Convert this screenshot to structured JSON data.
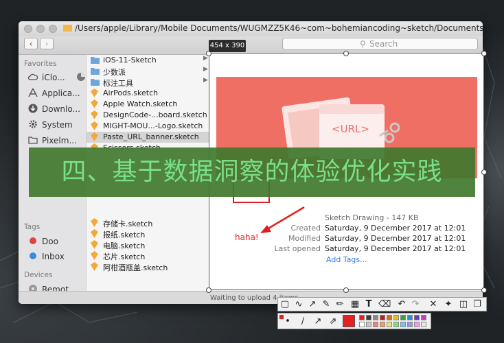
{
  "window": {
    "path": "/Users/apple/Library/Mobile Documents/WUGMZZ5K46~com~bohemiancoding~sketch/Documents",
    "search_placeholder": "Search",
    "status": "Waiting to upload 4 items"
  },
  "sidebar": {
    "favorites_header": "Favorites",
    "favorites": [
      "iClo...",
      "Applica...",
      "Downlo...",
      "System",
      "Pixelm..."
    ],
    "tags_header": "Tags",
    "tags": [
      {
        "label": "Doo",
        "color": "#e0443e"
      },
      {
        "label": "Inbox",
        "color": "#3c8be0"
      }
    ],
    "devices_header": "Devices",
    "devices": [
      "Remot..."
    ]
  },
  "files_top": [
    {
      "name": "iOS-11-Sketch",
      "type": "folder"
    },
    {
      "name": "少数派",
      "type": "folder"
    },
    {
      "name": "标注工具",
      "type": "folder"
    },
    {
      "name": "AirPods.sketch",
      "type": "sketch"
    },
    {
      "name": "Apple Watch.sketch",
      "type": "sketch"
    },
    {
      "name": "DesignCode-...board.sketch",
      "type": "sketch"
    },
    {
      "name": "MIGHT-MOU...-Logo.sketch",
      "type": "sketch"
    },
    {
      "name": "Paste_URL_banner.sketch",
      "type": "sketch"
    },
    {
      "name": "Scissors.sketch",
      "type": "sketch"
    }
  ],
  "files_bottom": [
    "存储卡.sketch",
    "报纸.sketch",
    "电脑.sketch",
    "芯片.sketch",
    "阿柑酒瓶盖.sketch"
  ],
  "selection": {
    "size_label": "454 x 390"
  },
  "banner": {
    "text": "四、基于数据洞察的体验优化实践"
  },
  "preview": {
    "url_text": "<URL>",
    "kind": "Sketch Drawing - 147 KB",
    "rows": [
      {
        "label": "Created",
        "value": "Saturday, 9 December 2017 at 12:01"
      },
      {
        "label": "Modified",
        "value": "Saturday, 9 December 2017 at 12:01"
      },
      {
        "label": "Last opened",
        "value": "Saturday, 9 December 2017 at 12:01"
      }
    ],
    "add_tags": "Add Tags...",
    "annotation": "haha!"
  },
  "colors": {
    "banner_bg": "#40782e",
    "banner_text": "#79e08a",
    "preview_coral": "#ef6f64",
    "annotation_red": "#e02020"
  },
  "toolbar_icons": [
    "rect-select",
    "pen",
    "arrow",
    "pencil",
    "marker",
    "mosaic",
    "text",
    "eraser",
    "undo",
    "redo",
    "close",
    "pin",
    "save",
    "copy"
  ],
  "palette": [
    "#e52020",
    "#3a3a3a",
    "#8b8b8b",
    "#b22222",
    "#d4701d",
    "#e0c020",
    "#3aa33a",
    "#2a8fd6",
    "#6040c0",
    "#c040c0",
    "#ffffff",
    "#c8c8c8",
    "#f08080",
    "#f0a060",
    "#f0e070",
    "#80e080",
    "#70c8f0",
    "#a090f0",
    "#f0a0e0",
    "#e8e8e8"
  ]
}
